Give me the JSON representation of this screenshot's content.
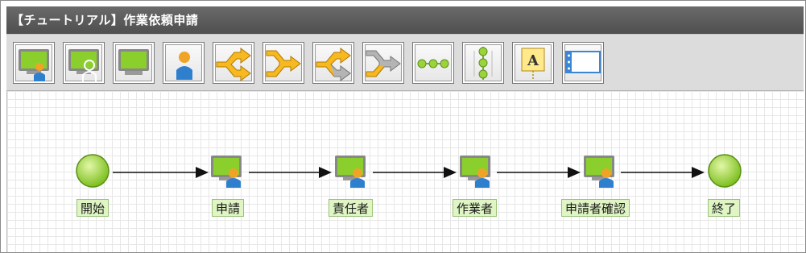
{
  "window": {
    "title": "【チュートリアル】作業依頼申請"
  },
  "toolbar": {
    "tools": [
      {
        "icon": "user-task-icon"
      },
      {
        "icon": "multi-user-task-icon"
      },
      {
        "icon": "screen-task-icon"
      },
      {
        "icon": "person-icon"
      },
      {
        "icon": "branch-split-icon"
      },
      {
        "icon": "branch-join-icon"
      },
      {
        "icon": "gray-branch-split-icon"
      },
      {
        "icon": "gray-branch-join-icon"
      },
      {
        "icon": "horizontal-sequence-icon"
      },
      {
        "icon": "vertical-sequence-icon"
      },
      {
        "icon": "text-annotation-icon"
      },
      {
        "icon": "window-panel-icon"
      }
    ]
  },
  "diagram": {
    "nodes": [
      {
        "id": "start",
        "type": "event",
        "label": "開始"
      },
      {
        "id": "apply",
        "type": "task",
        "label": "申請"
      },
      {
        "id": "manager",
        "type": "task",
        "label": "責任者"
      },
      {
        "id": "worker",
        "type": "task",
        "label": "作業者"
      },
      {
        "id": "confirm",
        "type": "task",
        "label": "申請者確認"
      },
      {
        "id": "end",
        "type": "event",
        "label": "終了"
      }
    ],
    "edges": [
      {
        "from": "start",
        "to": "apply"
      },
      {
        "from": "apply",
        "to": "manager"
      },
      {
        "from": "manager",
        "to": "worker"
      },
      {
        "from": "worker",
        "to": "confirm"
      },
      {
        "from": "confirm",
        "to": "end"
      }
    ],
    "colors": {
      "event_fill": "#9ad43a",
      "task_screen": "#8bcf2c",
      "person_head": "#f1a326",
      "person_body": "#2f7fcf",
      "edge": "#111111",
      "label_bg": "#dff5c4"
    }
  }
}
